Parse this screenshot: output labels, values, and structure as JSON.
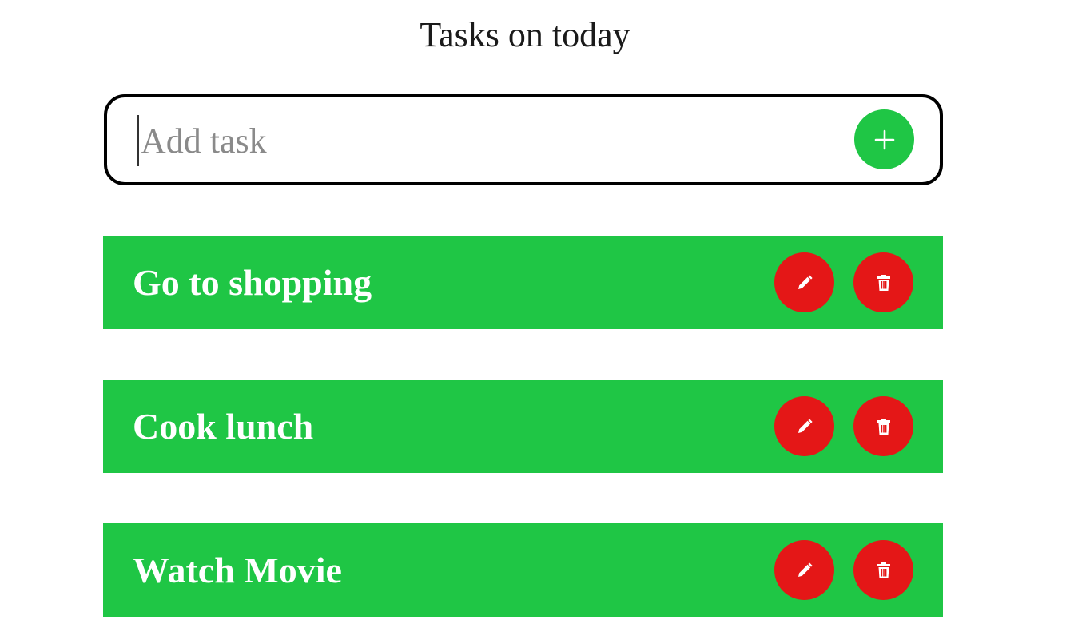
{
  "header": {
    "title": "Tasks on today"
  },
  "add_task": {
    "placeholder": "Add task",
    "value": "",
    "button_icon": "plus-icon"
  },
  "tasks": [
    {
      "label": "Go to shopping",
      "edit_icon": "pencil-icon",
      "delete_icon": "trash-icon"
    },
    {
      "label": "Cook lunch",
      "edit_icon": "pencil-icon",
      "delete_icon": "trash-icon"
    },
    {
      "label": "Watch Movie",
      "edit_icon": "pencil-icon",
      "delete_icon": "trash-icon"
    }
  ],
  "colors": {
    "task_background": "#1fc645",
    "add_button": "#1fc645",
    "action_buttons": "#e41717",
    "input_border": "#000000"
  }
}
